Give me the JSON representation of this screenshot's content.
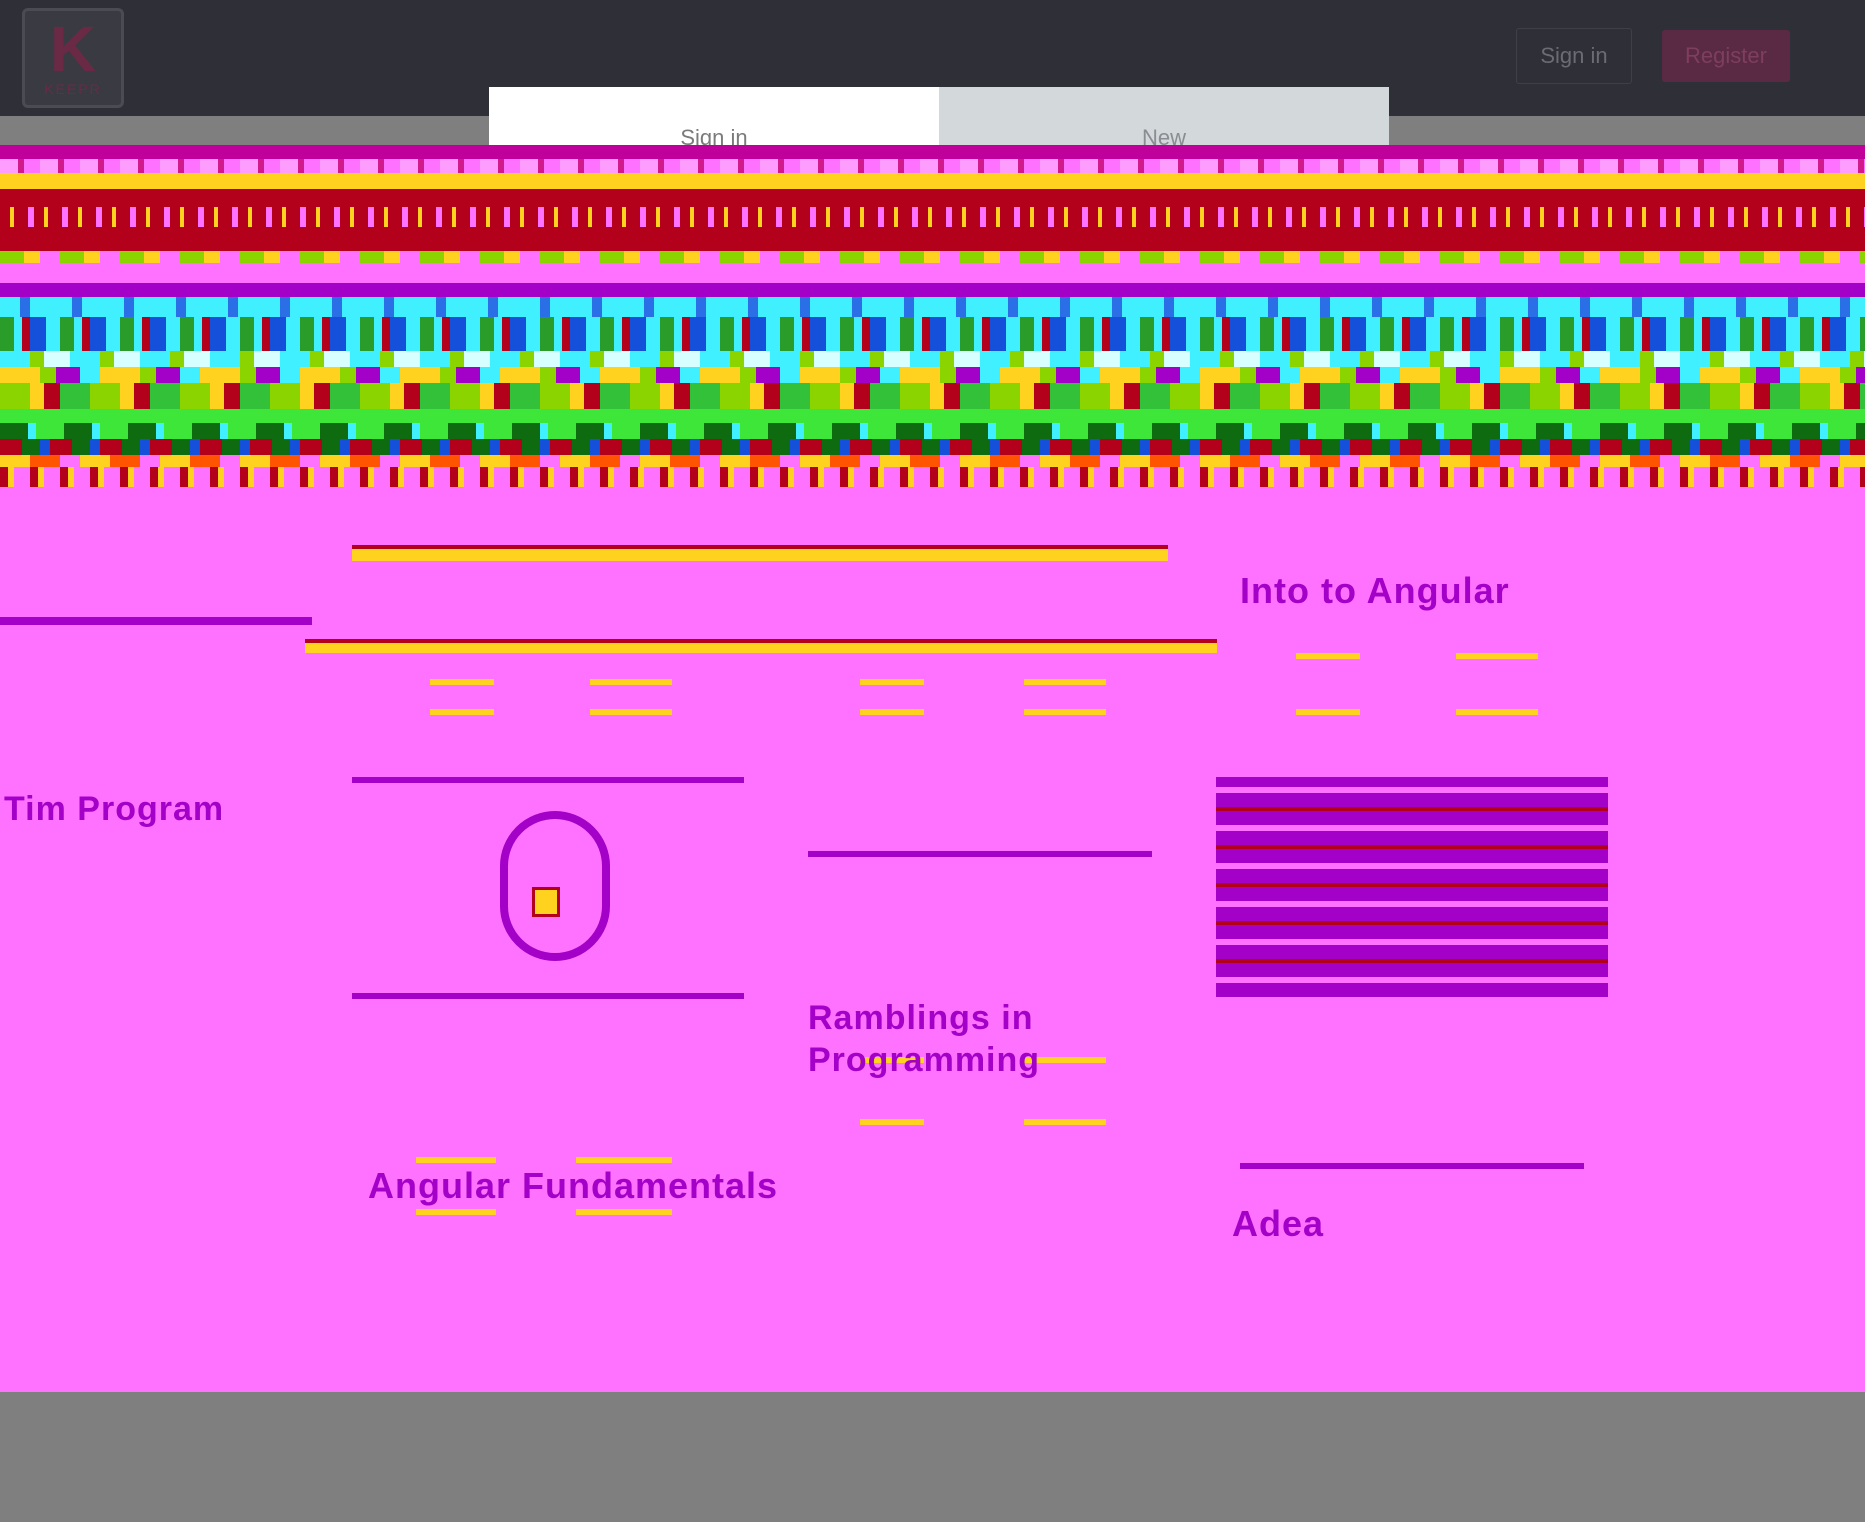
{
  "header": {
    "logo_letter": "K",
    "logo_word": "KEEPR",
    "signin_label": "Sign in",
    "register_label": "Register"
  },
  "modal": {
    "tabs": [
      {
        "label": "Sign in"
      },
      {
        "label": "New"
      }
    ]
  },
  "glitch_labels": [
    "Into to Angular",
    "Tim Program",
    "Ramblings in Programming",
    "Angular Fundamentals",
    "Adea"
  ],
  "colors": {
    "nav_bg": "#2f3037",
    "brand": "#5a2a45",
    "glitch_magenta": "#ff72ff",
    "glitch_purple": "#a300c8",
    "glitch_red": "#b3001b",
    "glitch_yellow": "#ffd21f",
    "backdrop": "#7f7f7f"
  }
}
